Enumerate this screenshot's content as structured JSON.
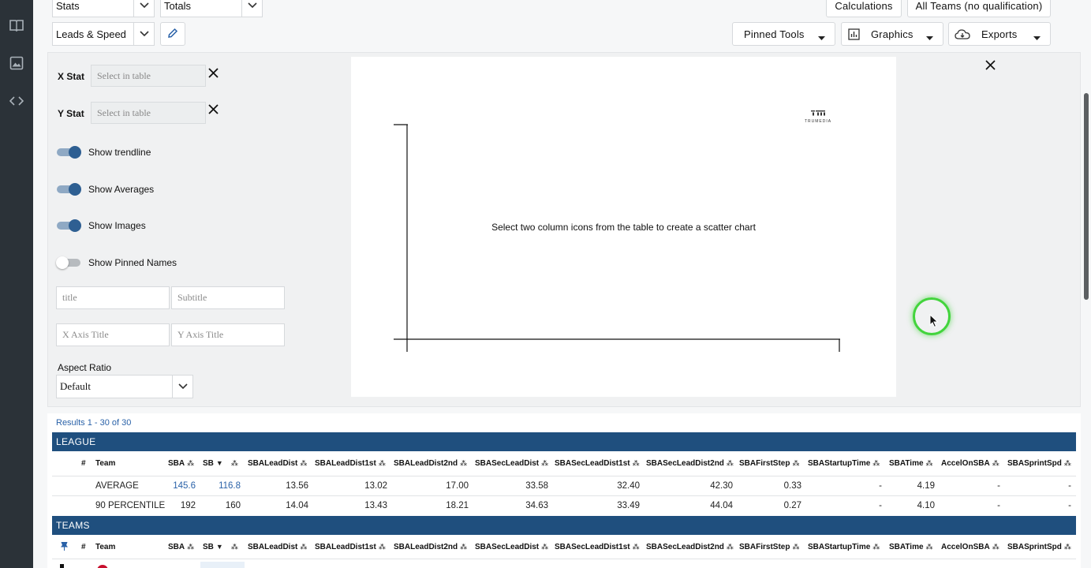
{
  "sidebar": {
    "icons": [
      "book-icon",
      "image-gallery-icon",
      "code-icon"
    ]
  },
  "toolbar": {
    "stats_select": "Stats",
    "totals_select": "Totals",
    "leads_select": "Leads & Speed",
    "calculations_label": "Calculations",
    "teams_label": "All Teams (no qualification)",
    "pinned_tools_label": "Pinned Tools",
    "graphics_label": "Graphics",
    "exports_label": "Exports"
  },
  "scatter_settings": {
    "x_stat_label": "X Stat",
    "x_stat_placeholder": "Select in table",
    "y_stat_label": "Y Stat",
    "y_stat_placeholder": "Select in table",
    "toggles": [
      {
        "label": "Show trendline",
        "on": true
      },
      {
        "label": "Show Averages",
        "on": true
      },
      {
        "label": "Show Images",
        "on": true
      },
      {
        "label": "Show Pinned Names",
        "on": false
      }
    ],
    "title_placeholder": "title",
    "subtitle_placeholder": "Subtitle",
    "x_axis_title_placeholder": "X Axis Title",
    "y_axis_title_placeholder": "Y Axis Title",
    "aspect_ratio_label": "Aspect Ratio",
    "aspect_ratio_value": "Default"
  },
  "chart": {
    "brand": "TRUMEDIA",
    "empty_message": "Select two column icons from the table to create a scatter chart"
  },
  "table": {
    "results_text": "Results 1 - 30 of 30",
    "league_label": "LEAGUE",
    "teams_label": "TEAMS",
    "columns": [
      "#",
      "Team",
      "SBA",
      "SB",
      "SBALeadDist",
      "SBALeadDist1st",
      "SBALeadDist2nd",
      "SBASecLeadDist",
      "SBASecLeadDist1st",
      "SBASecLeadDist2nd",
      "SBAFirstStep",
      "SBAStartupTime",
      "SBATime",
      "AccelOnSBA",
      "SBASprintSpd"
    ],
    "league_rows": [
      {
        "team": "AVERAGE",
        "cells": [
          "145.6",
          "116.8",
          "13.56",
          "13.02",
          "17.00",
          "33.58",
          "32.40",
          "42.30",
          "0.33",
          "-",
          "4.19",
          "-",
          "-"
        ]
      },
      {
        "team": "90 PERCENTILE",
        "cells": [
          "192",
          "160",
          "14.04",
          "13.43",
          "18.21",
          "34.63",
          "33.49",
          "44.04",
          "0.27",
          "-",
          "4.10",
          "-",
          "-"
        ]
      }
    ]
  },
  "colors": {
    "section_bar": "#1f4f7e",
    "toggle_on": "#2e5f92",
    "link": "#2a62a8",
    "rail": "#2b3238"
  }
}
